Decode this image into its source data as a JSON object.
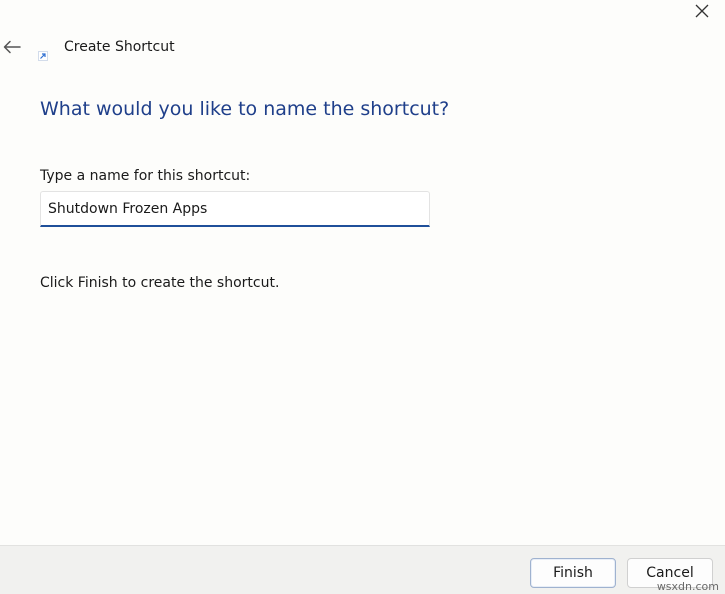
{
  "window": {
    "title": "Create Shortcut"
  },
  "icons": {
    "close": "close-icon",
    "back": "back-arrow-icon",
    "app": "shortcut-arrow-icon"
  },
  "main": {
    "heading": "What would you like to name the shortcut?",
    "field_label": "Type a name for this shortcut:",
    "name_value": "Shutdown Frozen Apps",
    "hint": "Click Finish to create the shortcut."
  },
  "footer": {
    "finish_label": "Finish",
    "cancel_label": "Cancel"
  },
  "watermark": "wsxdn.com",
  "colors": {
    "heading": "#1f3f8a",
    "input_underline": "#1f4f9a",
    "footer_bg": "#f1f1ef"
  }
}
